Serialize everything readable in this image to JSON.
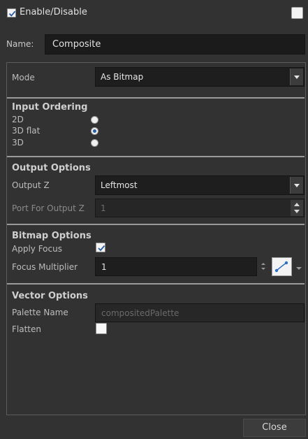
{
  "header": {
    "enable_label": "Enable/Disable",
    "enable_checked": true
  },
  "name": {
    "label": "Name:",
    "value": "Composite"
  },
  "mode": {
    "label": "Mode",
    "value": "As Bitmap"
  },
  "input_ordering": {
    "title": "Input Ordering",
    "options": [
      {
        "label": "2D",
        "selected": false
      },
      {
        "label": "3D flat",
        "selected": true
      },
      {
        "label": "3D",
        "selected": false
      }
    ]
  },
  "output_options": {
    "title": "Output Options",
    "output_z_label": "Output Z",
    "output_z_value": "Leftmost",
    "port_label": "Port For Output Z",
    "port_value": "1"
  },
  "bitmap_options": {
    "title": "Bitmap Options",
    "apply_focus_label": "Apply Focus",
    "apply_focus_checked": true,
    "focus_multiplier_label": "Focus Multiplier",
    "focus_multiplier_value": "1"
  },
  "vector_options": {
    "title": "Vector Options",
    "palette_name_label": "Palette Name",
    "palette_name_placeholder": "compositedPalette",
    "flatten_label": "Flatten",
    "flatten_checked": false
  },
  "footer": {
    "close_label": "Close"
  },
  "colors": {
    "background": "#323232",
    "field": "#1e1e1e",
    "radio_selected": "#2b5f9e"
  }
}
